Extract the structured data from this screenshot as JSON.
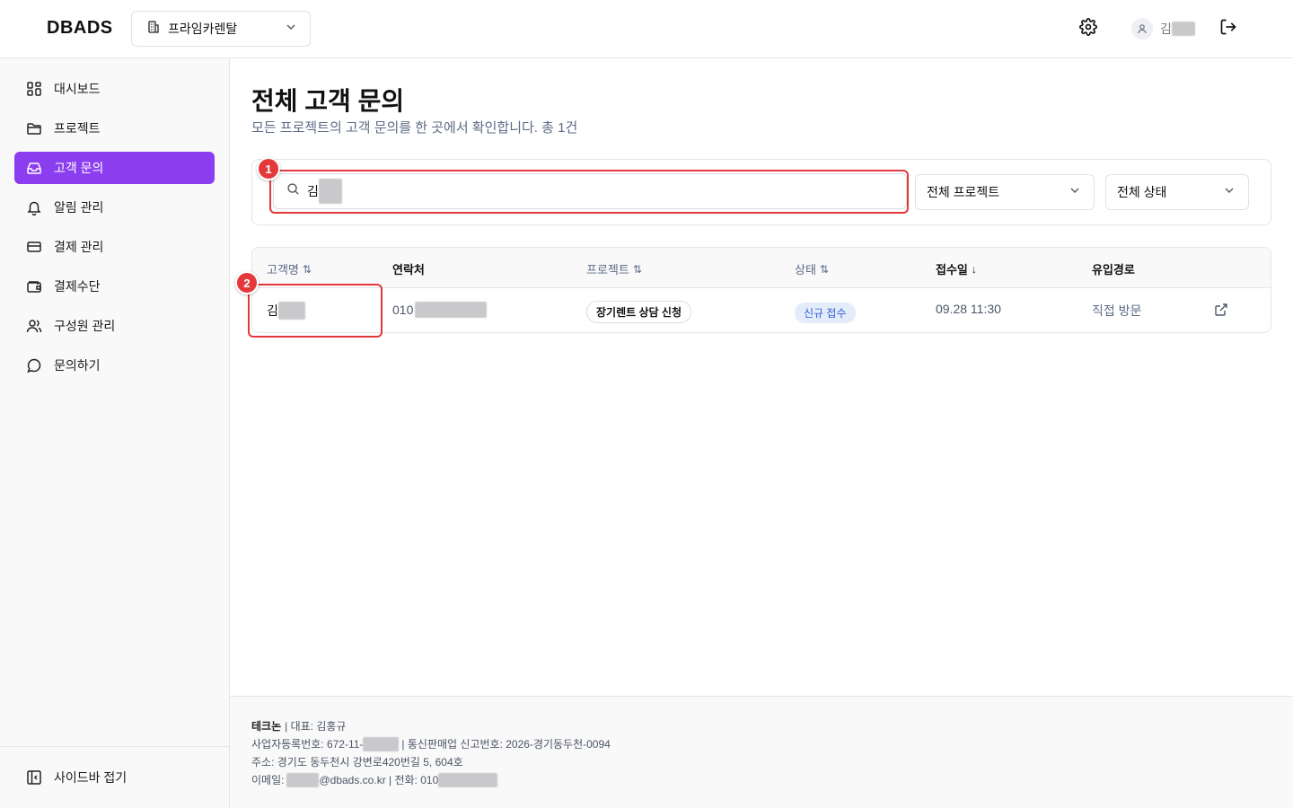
{
  "header": {
    "logo": "DBADS",
    "company_select": "프라임카렌탈",
    "user_initial": "김"
  },
  "sidebar": {
    "items": [
      {
        "label": "대시보드",
        "icon": "dashboard-icon"
      },
      {
        "label": "프로젝트",
        "icon": "folder-icon"
      },
      {
        "label": "고객 문의",
        "icon": "inbox-icon",
        "active": true
      },
      {
        "label": "알림 관리",
        "icon": "bell-icon"
      },
      {
        "label": "결제 관리",
        "icon": "credit-card-icon"
      },
      {
        "label": "결제수단",
        "icon": "wallet-icon"
      },
      {
        "label": "구성원 관리",
        "icon": "users-icon"
      },
      {
        "label": "문의하기",
        "icon": "chat-bubble-icon"
      }
    ],
    "collapse_label": "사이드바 접기"
  },
  "page": {
    "title": "전체 고객 문의",
    "subtitle": "모든 프로젝트의 고객 문의를 한 곳에서 확인합니다. 총 1건"
  },
  "filters": {
    "search_value": "김",
    "project_select": "전체 프로젝트",
    "status_select": "전체 상태"
  },
  "annotations": {
    "marker1": "1",
    "marker2": "2"
  },
  "table": {
    "headers": {
      "name": "고객명",
      "contact": "연락처",
      "project": "프로젝트",
      "status": "상태",
      "date": "접수일",
      "source": "유입경로"
    },
    "rows": [
      {
        "name": "김",
        "contact": "010",
        "project": "장기렌트 상담 신청",
        "status": "신규 접수",
        "date": "09.28 11:30",
        "source": "직접 방문"
      }
    ]
  },
  "footer": {
    "company": "테크논",
    "rep_label": "| 대표: 김홍규",
    "biz_prefix": "사업자등록번호: 672-11-",
    "biz_suffix": "| 통신판매업 신고번호: 2026-경기동두천-0094",
    "address": "주소: 경기도 동두천시 강변로420번길 5, 604호",
    "email_prefix": "이메일:",
    "email_suffix": "@dbads.co.kr | 전화: 010"
  },
  "colors": {
    "accent": "#8b3df0",
    "highlight": "#e5383b",
    "badge_text": "#2f5fd1",
    "badge_bg": "#e4ecfb"
  }
}
